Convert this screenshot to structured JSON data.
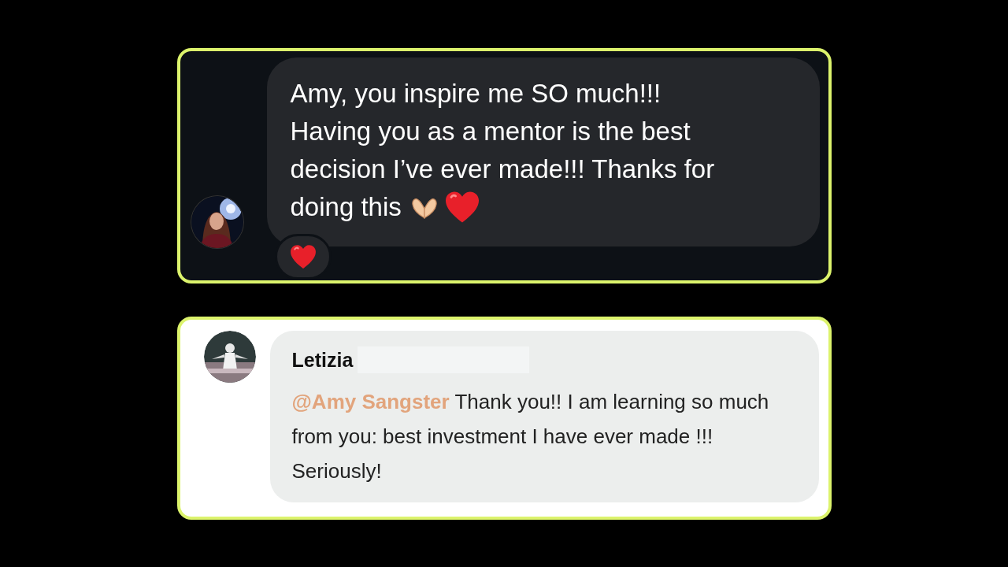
{
  "messages": [
    {
      "kind": "dark",
      "lines": [
        "Amy, you inspire me SO much!!!",
        "Having you as a mentor is the best",
        "decision I’ve ever made!!! Thanks for",
        "doing this"
      ]
    },
    {
      "kind": "light",
      "author": "Letizia",
      "mention": "@Amy Sangster",
      "text": "Thank you!! I am learning so much from you: best investment I have ever made !!! Seriously!"
    }
  ]
}
